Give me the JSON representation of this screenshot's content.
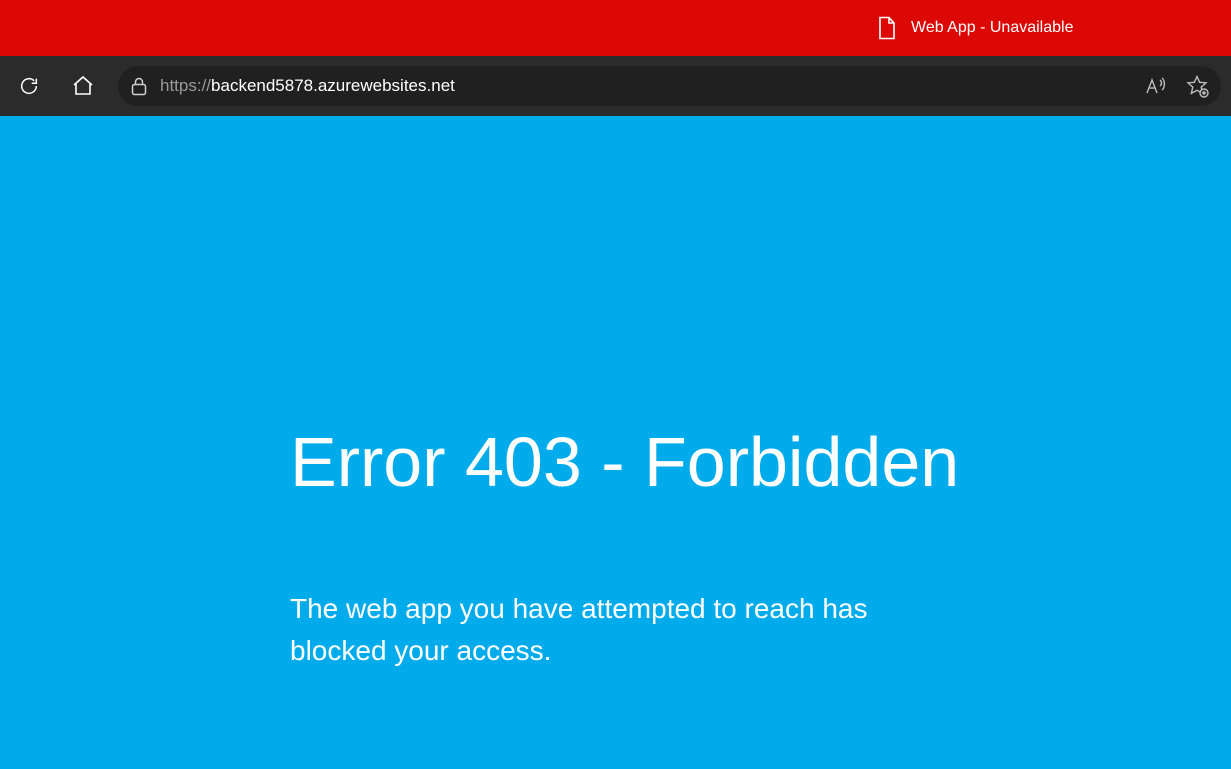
{
  "tab": {
    "title": "Web App - Unavailable"
  },
  "address": {
    "scheme": "https://",
    "host": "backend5878.azurewebsites.net"
  },
  "page": {
    "heading": "Error 403 - Forbidden",
    "message": "The web app you have attempted to reach has blocked your access."
  }
}
